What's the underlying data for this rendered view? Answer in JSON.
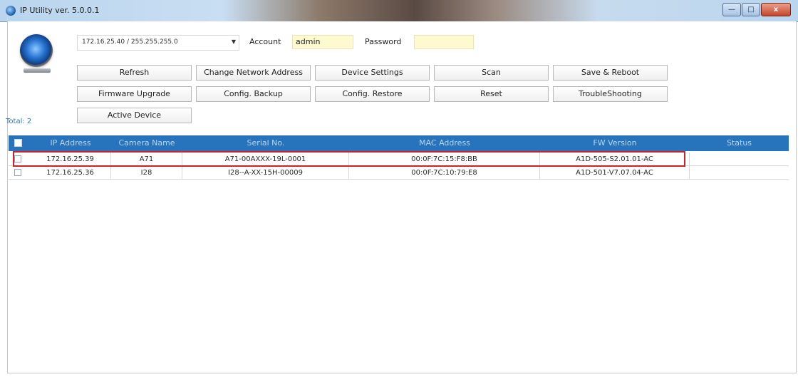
{
  "window": {
    "title": "IP Utility ver. 5.0.0.1",
    "minimize": "—",
    "maximize": "□",
    "close": "x"
  },
  "connection": {
    "ip_mask": "172.16.25.40 / 255.255.255.0",
    "account_label": "Account",
    "account_value": "admin",
    "password_label": "Password",
    "password_value": ""
  },
  "buttons": {
    "refresh": "Refresh",
    "change_network_address": "Change Network Address",
    "device_settings": "Device Settings",
    "scan": "Scan",
    "save_reboot": "Save & Reboot",
    "firmware_upgrade": "Firmware Upgrade",
    "config_backup": "Config. Backup",
    "config_restore": "Config. Restore",
    "reset": "Reset",
    "troubleshooting": "TroubleShooting",
    "active_device": "Active Device"
  },
  "total_label": "Total: 2",
  "table": {
    "columns": [
      "IP Address",
      "Camera Name",
      "Serial No.",
      "MAC Address",
      "FW Version",
      "Status"
    ],
    "rows": [
      {
        "ip": "172.16.25.39",
        "name": "A71",
        "serial": "A71-00AXXX-19L-0001",
        "mac": "00:0F:7C:15:F8:BB",
        "fw": "A1D-505-S2.01.01-AC",
        "status": ""
      },
      {
        "ip": "172.16.25.36",
        "name": "I28",
        "serial": "I28--A-XX-15H-00009",
        "mac": "00:0F:7C:10:79:E8",
        "fw": "A1D-501-V7.07.04-AC",
        "status": ""
      }
    ]
  },
  "colors": {
    "header_bg": "#2874bc",
    "highlight_border": "#d0202a",
    "field_bg": "#fff9cf"
  }
}
